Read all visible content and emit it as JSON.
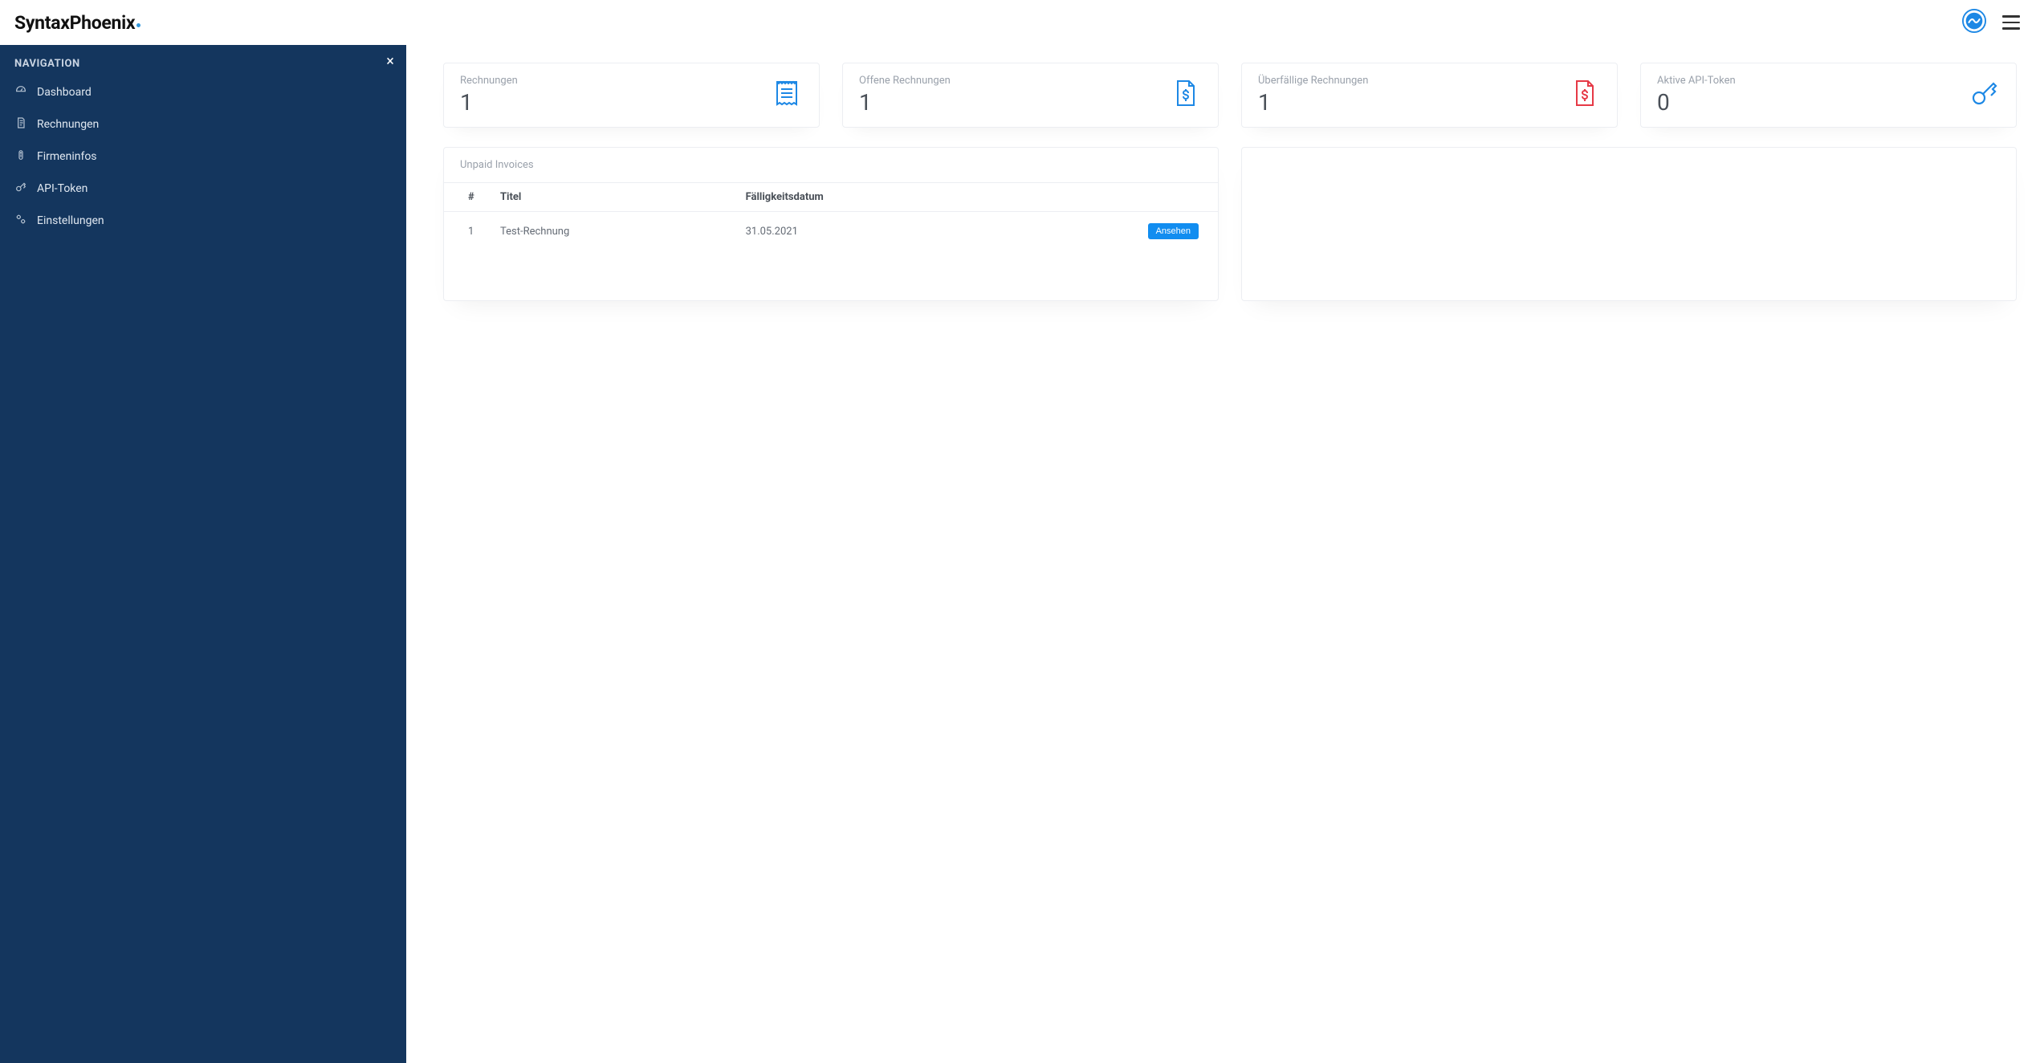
{
  "header": {
    "brand": "SyntaxPhoenix"
  },
  "sidebar": {
    "title": "NAVIGATION",
    "items": [
      {
        "label": "Dashboard"
      },
      {
        "label": "Rechnungen"
      },
      {
        "label": "Firmeninfos"
      },
      {
        "label": "API-Token"
      },
      {
        "label": "Einstellungen"
      }
    ]
  },
  "stats": [
    {
      "label": "Rechnungen",
      "value": "1"
    },
    {
      "label": "Offene Rechnungen",
      "value": "1"
    },
    {
      "label": "Überfällige Rechnungen",
      "value": "1"
    },
    {
      "label": "Aktive API-Token",
      "value": "0"
    }
  ],
  "unpaid_panel": {
    "title": "Unpaid Invoices",
    "columns": {
      "num": "#",
      "title": "Titel",
      "due": "Fälligkeitsdatum"
    },
    "rows": [
      {
        "num": "1",
        "title": "Test-Rechnung",
        "due": "31.05.2021",
        "action": "Ansehen"
      }
    ]
  }
}
